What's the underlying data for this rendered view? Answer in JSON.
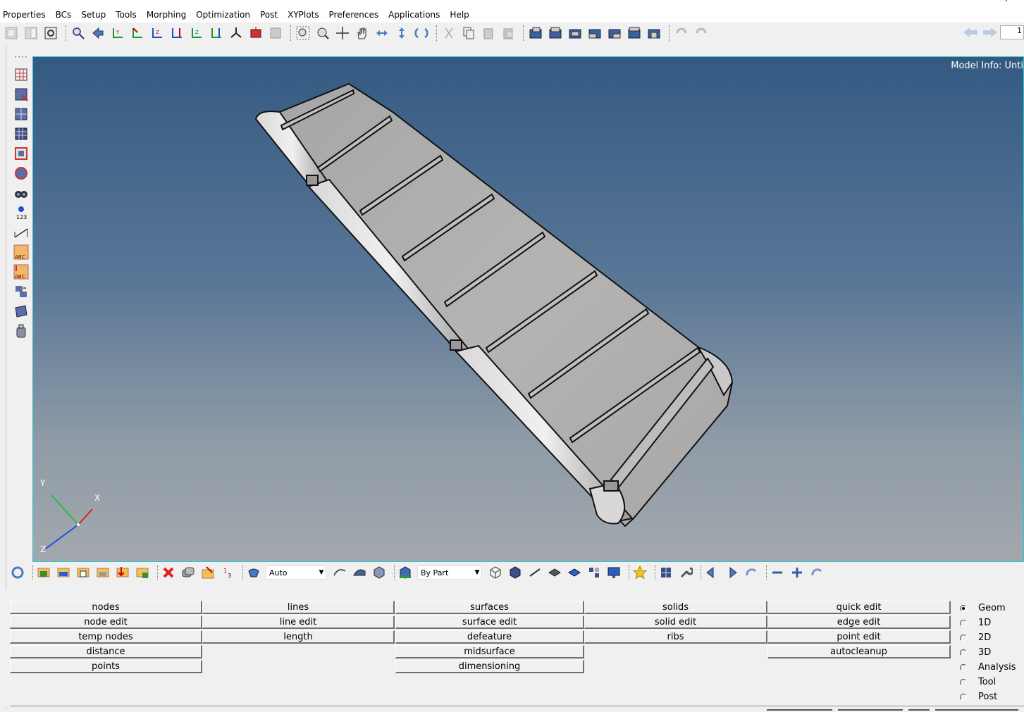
{
  "menu": [
    "Properties",
    "BCs",
    "Setup",
    "Tools",
    "Morphing",
    "Optimization",
    "Post",
    "XYPlots",
    "Preferences",
    "Applications",
    "Help"
  ],
  "top_input_value": "1",
  "viewport": {
    "model_info": "Model Info: Unti",
    "triad": {
      "y": "Y",
      "x": "X",
      "z": "Z"
    }
  },
  "bottom_toolbar": {
    "vis_mode": "Auto",
    "color_mode": "By Part"
  },
  "panel": {
    "columns": [
      [
        "nodes",
        "node edit",
        "temp nodes",
        "distance",
        "points"
      ],
      [
        "lines",
        "line edit",
        "length"
      ],
      [
        "surfaces",
        "surface edit",
        "defeature",
        "midsurface",
        "dimensioning"
      ],
      [
        "solids",
        "solid edit",
        "ribs"
      ],
      [
        "quick edit",
        "edge edit",
        "point edit",
        "autocleanup"
      ]
    ],
    "pages": [
      "Geom",
      "1D",
      "2D",
      "3D",
      "Analysis",
      "Tool",
      "Post"
    ],
    "selected_page": "Geom"
  },
  "colors": {
    "viewport_top": "#345a82",
    "viewport_bottom": "#a3a8ad",
    "viewport_border": "#27c5d8",
    "model_fill": "#b3b3b3"
  }
}
